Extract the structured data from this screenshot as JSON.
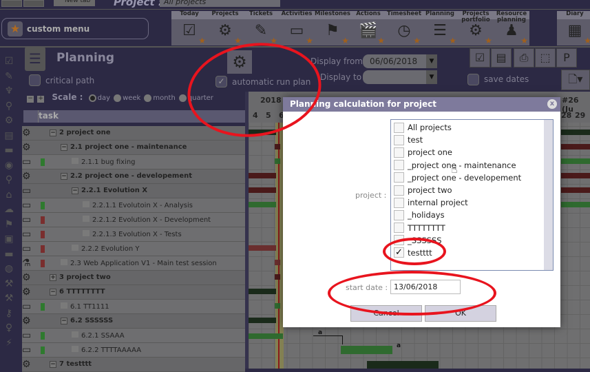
{
  "topbar": {
    "new_tab": "New tab",
    "project_label": "Project :",
    "project_value": "All projects"
  },
  "custom_menu": "custom menu",
  "menu": [
    {
      "label": "Today",
      "icon": "calendar-check-icon"
    },
    {
      "label": "Projects",
      "icon": "gear-icon"
    },
    {
      "label": "Tickets",
      "icon": "ticket-icon"
    },
    {
      "label": "Activities",
      "icon": "monitor-icon"
    },
    {
      "label": "Milestones",
      "icon": "flag-icon"
    },
    {
      "label": "Actions",
      "icon": "clapperboard-icon"
    },
    {
      "label": "Timesheet",
      "icon": "clock-icon"
    },
    {
      "label": "Planning",
      "icon": "gantt-icon"
    },
    {
      "label": "Projects portfolio",
      "icon": "portfolio-icon"
    },
    {
      "label": "Resource planning",
      "icon": "resource-icon"
    },
    {
      "label": "Diary",
      "icon": "diary-icon"
    }
  ],
  "planning": {
    "title": "Planning",
    "critical_path": "critical path",
    "automatic_run_plan": "automatic run plan",
    "display_from_label": "Display from",
    "display_from": "06/06/2018",
    "display_to_label": "Display to",
    "display_to": "",
    "save_dates": "save dates",
    "scale_label": "Scale :",
    "scales": [
      "day",
      "week",
      "month",
      "quarter"
    ],
    "scale_selected": "day",
    "task_header": "task"
  },
  "gantt": {
    "year": "2018",
    "week": "#26 (Ju",
    "days_left": [
      "4",
      "5",
      "6"
    ],
    "days_right": [
      "28",
      "29"
    ],
    "link_labels": [
      "a",
      "a"
    ]
  },
  "tasks": [
    {
      "text": "2 project one",
      "bold": true,
      "level": 0,
      "toggle": "−",
      "icon": "gear",
      "color": ""
    },
    {
      "text": "2.1 project one - maintenance",
      "bold": true,
      "level": 1,
      "toggle": "−",
      "icon": "gear",
      "color": ""
    },
    {
      "text": "2.1.1 bug fixing",
      "bold": false,
      "level": 2,
      "toggle": "",
      "icon": "monitor",
      "color": "#2e7a2e"
    },
    {
      "text": "2.2 project one - developement",
      "bold": true,
      "level": 1,
      "toggle": "−",
      "icon": "gear",
      "color": ""
    },
    {
      "text": "2.2.1 Evolution X",
      "bold": true,
      "level": 2,
      "toggle": "−",
      "icon": "monitor",
      "color": ""
    },
    {
      "text": "2.2.1.1 Evolutoin X - Analysis",
      "bold": false,
      "level": 3,
      "toggle": "",
      "icon": "monitor",
      "color": "#2e7a2e"
    },
    {
      "text": "2.2.1.2 Evolution X - Development",
      "bold": false,
      "level": 3,
      "toggle": "",
      "icon": "monitor",
      "color": "#7a2e2e"
    },
    {
      "text": "2.2.1.3 Evolution X - Tests",
      "bold": false,
      "level": 3,
      "toggle": "",
      "icon": "monitor",
      "color": "#7a2e2e"
    },
    {
      "text": "2.2.2 Evolution Y",
      "bold": false,
      "level": 2,
      "toggle": "",
      "icon": "monitor",
      "color": "#7a2e2e"
    },
    {
      "text": "2.3 Web Application V1 - Main test session",
      "bold": false,
      "level": 1,
      "toggle": "",
      "icon": "test",
      "color": "#7a2e2e"
    },
    {
      "text": "3 project two",
      "bold": true,
      "level": 0,
      "toggle": "+",
      "icon": "gear",
      "color": ""
    },
    {
      "text": "6 TTTTTTTT",
      "bold": true,
      "level": 0,
      "toggle": "−",
      "icon": "gear-orange",
      "color": ""
    },
    {
      "text": "6.1 TT1111",
      "bold": false,
      "level": 1,
      "toggle": "",
      "icon": "monitor",
      "color": "#2e7a2e"
    },
    {
      "text": "6.2 SSSSSS",
      "bold": true,
      "level": 1,
      "toggle": "−",
      "icon": "gear-orange",
      "color": ""
    },
    {
      "text": "6.2.1 SSAAA",
      "bold": false,
      "level": 2,
      "toggle": "",
      "icon": "monitor",
      "color": "#2e7a2e"
    },
    {
      "text": "6.2.2 TTTTAAAAA",
      "bold": false,
      "level": 2,
      "toggle": "",
      "icon": "monitor",
      "color": "#2e7a2e"
    },
    {
      "text": "7 testttt",
      "bold": true,
      "level": 0,
      "toggle": "−",
      "icon": "gear",
      "color": ""
    }
  ],
  "dialog": {
    "title": "Planning calculation for project",
    "close": "x",
    "project_label": "project :",
    "projects": [
      {
        "label": "All projects",
        "checked": false
      },
      {
        "label": "test",
        "checked": false
      },
      {
        "label": "project one",
        "checked": false
      },
      {
        "label": "_project one - maintenance",
        "checked": false
      },
      {
        "label": "_project one - developement",
        "checked": false
      },
      {
        "label": "project two",
        "checked": false
      },
      {
        "label": "internal project",
        "checked": false
      },
      {
        "label": "_holidays",
        "checked": false
      },
      {
        "label": "TTTTTTTT",
        "checked": false
      },
      {
        "label": "_SSSSSS",
        "checked": false
      },
      {
        "label": "testttt",
        "checked": true
      }
    ],
    "start_date_label": "start date :",
    "start_date": "13/06/2018",
    "cancel": "Cancel",
    "ok": "OK"
  },
  "colors": {
    "annotation": "#e8141e",
    "dialog_header": "#7e7a9c",
    "bg": "#2c2944"
  }
}
